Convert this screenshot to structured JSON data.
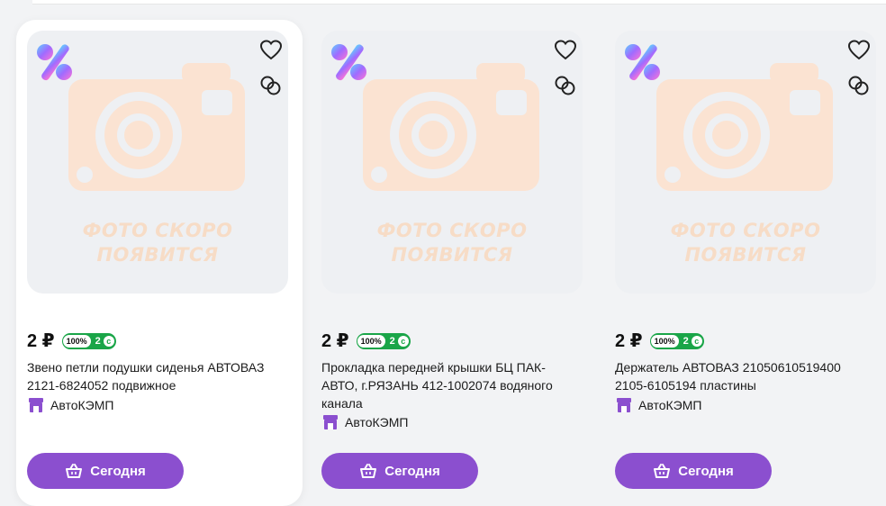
{
  "placeholder": {
    "line1": "ФОТО СКОРО",
    "line2": "ПОЯВИТСЯ"
  },
  "colors": {
    "button": "#8b4fcf",
    "bonus": "#1aa548",
    "placeholder": "#f7dcc6"
  },
  "icons": {
    "promo": "percent-icon",
    "favorite": "heart-icon",
    "compare": "compare-icon",
    "seller": "shop-icon",
    "button": "basket-icon"
  },
  "products": [
    {
      "price": "2 ₽",
      "bonus_percent": "100%",
      "bonus_amount": "2",
      "title": "Звено петли подушки сиденья АВТОВАЗ 2121-6824052 подвижное",
      "seller": "АвтоКЭМП",
      "button": "Сегодня"
    },
    {
      "price": "2 ₽",
      "bonus_percent": "100%",
      "bonus_amount": "2",
      "title": "Прокладка передней крышки БЦ ПАК-АВТО, г.РЯЗАНЬ 412-1002074 водяного канала",
      "seller": "АвтоКЭМП",
      "button": "Сегодня"
    },
    {
      "price": "2 ₽",
      "bonus_percent": "100%",
      "bonus_amount": "2",
      "title": "Держатель АВТОВАЗ 21050610519400 2105-6105194 пластины",
      "seller": "АвтоКЭМП",
      "button": "Сегодня"
    }
  ]
}
